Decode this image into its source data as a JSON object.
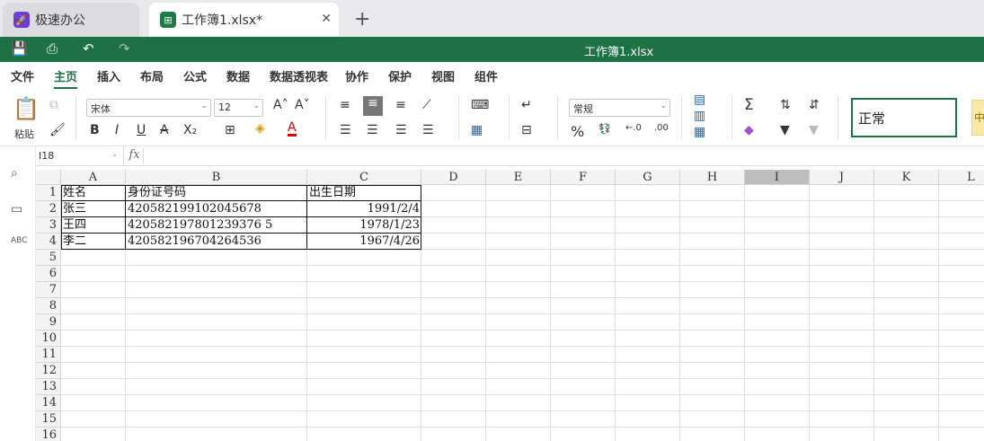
{
  "tabs": [
    {
      "label": "极速办公",
      "icon": "rocket-icon"
    },
    {
      "label": "工作簿1.xlsx*",
      "icon": "spreadsheet-icon"
    }
  ],
  "titlebar": {
    "title": "工作簿1.xlsx"
  },
  "menu": [
    "文件",
    "主页",
    "插入",
    "布局",
    "公式",
    "数据",
    "数据透视表",
    "协作",
    "保护",
    "视图",
    "组件"
  ],
  "menu_active": "主页",
  "ribbon": {
    "paste_label": "粘贴",
    "font_name": "宋体",
    "font_size": "12",
    "number_format": "常规",
    "style_normal": "正常",
    "style_next": "中"
  },
  "namebox": "I18",
  "fx_label": "fx",
  "columns": [
    "A",
    "B",
    "C",
    "D",
    "E",
    "F",
    "G",
    "H",
    "I",
    "J",
    "K",
    "L"
  ],
  "active_column": "I",
  "rows": [
    "1",
    "2",
    "3",
    "4",
    "5",
    "6",
    "7",
    "8",
    "9",
    "10",
    "11",
    "12",
    "13",
    "14",
    "15",
    "16"
  ],
  "cells": [
    [
      "姓名",
      "身份证号码",
      "出生日期"
    ],
    [
      "张三",
      "420582199102045678",
      "1991/2/4"
    ],
    [
      "王四",
      "420582197801239376 5",
      "1978/1/23"
    ],
    [
      "李二",
      "420582196704264536",
      "1967/4/26"
    ]
  ]
}
